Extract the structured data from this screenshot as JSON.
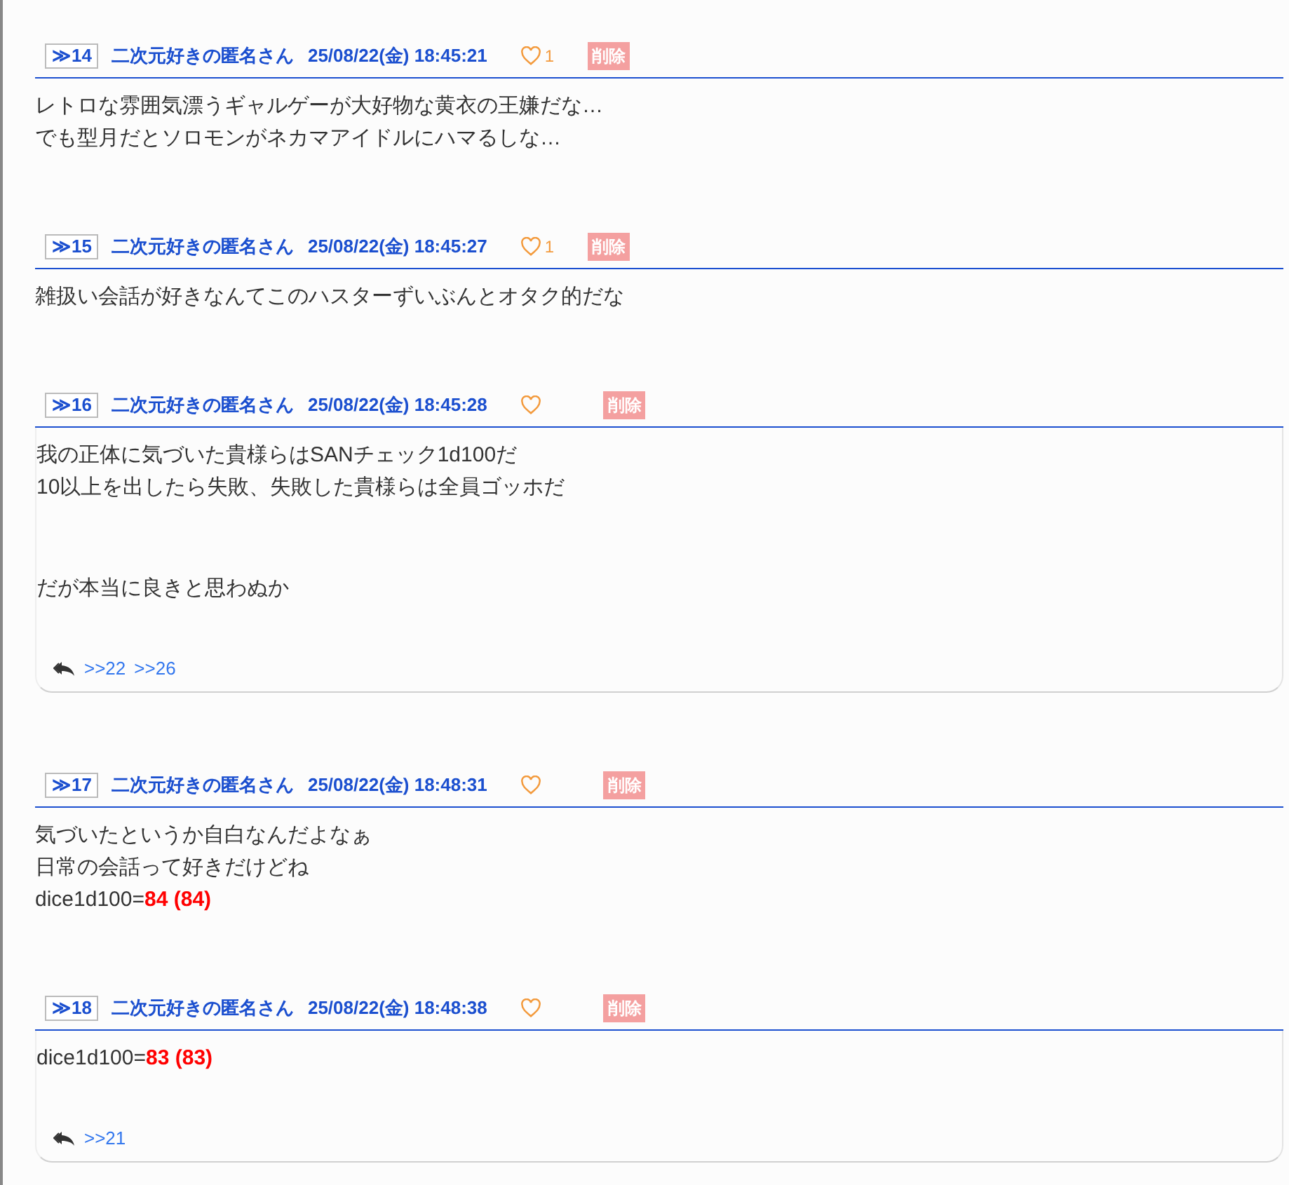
{
  "posts": [
    {
      "number": "≫14",
      "name": "二次元好きの匿名さん",
      "date": "25/08/22(金) 18:45:21",
      "likes": "1",
      "delete_label": "削除",
      "paragraphs": [
        [
          {
            "kind": "text",
            "text": "レトロな雰囲気漂うギャルゲーが大好物な黄衣の王嫌だな…"
          },
          {
            "kind": "text",
            "text": "でも型月だとソロモンがネカマアイドルにハマるしな…"
          }
        ]
      ]
    },
    {
      "number": "≫15",
      "name": "二次元好きの匿名さん",
      "date": "25/08/22(金) 18:45:27",
      "likes": "1",
      "delete_label": "削除",
      "paragraphs": [
        [
          {
            "kind": "text",
            "text": "雑扱い会話が好きなんてこのハスターずいぶんとオタク的だな"
          }
        ]
      ]
    },
    {
      "number": "≫16",
      "name": "二次元好きの匿名さん",
      "date": "25/08/22(金) 18:45:28",
      "delete_label": "削除",
      "paragraphs": [
        [
          {
            "kind": "text",
            "text": "我の正体に気づいた貴様らはSANチェック1d100だ"
          },
          {
            "kind": "text",
            "text": "10以上を出したら失敗、失敗した貴様らは全員ゴッホだ"
          }
        ],
        [
          {
            "kind": "text",
            "text": "だが本当に良きと思わぬか"
          }
        ]
      ],
      "replies": [
        ">>22",
        ">>26"
      ]
    },
    {
      "number": "≫17",
      "name": "二次元好きの匿名さん",
      "date": "25/08/22(金) 18:48:31",
      "delete_label": "削除",
      "paragraphs": [
        [
          {
            "kind": "text",
            "text": "気づいたというか自白なんだよなぁ"
          },
          {
            "kind": "text",
            "text": "日常の会話って好きだけどね"
          },
          {
            "kind": "dice",
            "text": "dice1d100=",
            "result": "84 (84)"
          }
        ]
      ]
    },
    {
      "number": "≫18",
      "name": "二次元好きの匿名さん",
      "date": "25/08/22(金) 18:48:38",
      "delete_label": "削除",
      "paragraphs": [
        [
          {
            "kind": "dice",
            "text": "dice1d100=",
            "result": "83 (83)"
          }
        ]
      ],
      "replies": [
        ">>21"
      ]
    }
  ]
}
